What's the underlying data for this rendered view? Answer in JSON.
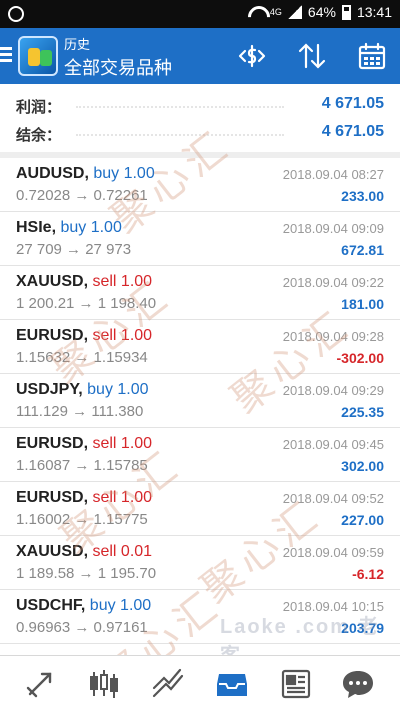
{
  "status_bar": {
    "network_type": "4G",
    "battery_percent": "64%",
    "time": "13:41"
  },
  "toolbar": {
    "title": "历史",
    "subtitle": "全部交易品种",
    "colors": {
      "background": "#1e6fc6"
    }
  },
  "summary": {
    "profit_label": "利润：",
    "profit_value": "4 671.05",
    "balance_label": "结余：",
    "balance_value": "4 671.05"
  },
  "trades": [
    {
      "symbol": "AUDUSD,",
      "side": "buy",
      "side_label": "buy 1.00",
      "prices": "0.72028 → 0.72261",
      "time": "2018.09.04 08:27",
      "profit": "233.00",
      "profit_sign": "pos"
    },
    {
      "symbol": "HSIe,",
      "side": "buy",
      "side_label": "buy 1.00",
      "prices": "27 709 → 27 973",
      "time": "2018.09.04 09:09",
      "profit": "672.81",
      "profit_sign": "pos"
    },
    {
      "symbol": "XAUUSD,",
      "side": "sell",
      "side_label": "sell 1.00",
      "prices": "1 200.21 → 1 198.40",
      "time": "2018.09.04 09:22",
      "profit": "181.00",
      "profit_sign": "pos"
    },
    {
      "symbol": "EURUSD,",
      "side": "sell",
      "side_label": "sell 1.00",
      "prices": "1.15632 → 1.15934",
      "time": "2018.09.04 09:28",
      "profit": "-302.00",
      "profit_sign": "neg"
    },
    {
      "symbol": "USDJPY,",
      "side": "buy",
      "side_label": "buy 1.00",
      "prices": "111.129 → 111.380",
      "time": "2018.09.04 09:29",
      "profit": "225.35",
      "profit_sign": "pos"
    },
    {
      "symbol": "EURUSD,",
      "side": "sell",
      "side_label": "sell 1.00",
      "prices": "1.16087 → 1.15785",
      "time": "2018.09.04 09:45",
      "profit": "302.00",
      "profit_sign": "pos"
    },
    {
      "symbol": "EURUSD,",
      "side": "sell",
      "side_label": "sell 1.00",
      "prices": "1.16002 → 1.15775",
      "time": "2018.09.04 09:52",
      "profit": "227.00",
      "profit_sign": "pos"
    },
    {
      "symbol": "XAUUSD,",
      "side": "sell",
      "side_label": "sell 0.01",
      "prices": "1 189.58 → 1 195.70",
      "time": "2018.09.04 09:59",
      "profit": "-6.12",
      "profit_sign": "neg"
    },
    {
      "symbol": "USDCHF,",
      "side": "buy",
      "side_label": "buy 1.00",
      "prices": "0.96963 → 0.97161",
      "time": "2018.09.04 10:15",
      "profit": "203.79",
      "profit_sign": "pos"
    }
  ],
  "watermarks": {
    "text": "聚心汇",
    "site_logo": "Laoke .com 老客"
  },
  "bottom_nav": [
    {
      "icon": "quotes-icon"
    },
    {
      "icon": "chart-icon"
    },
    {
      "icon": "trade-icon"
    },
    {
      "icon": "history-icon",
      "active": true
    },
    {
      "icon": "news-icon"
    },
    {
      "icon": "messages-icon"
    }
  ],
  "colors": {
    "accent": "#1e6fc6",
    "buy": "#1e6fc6",
    "sell": "#d6262a"
  }
}
